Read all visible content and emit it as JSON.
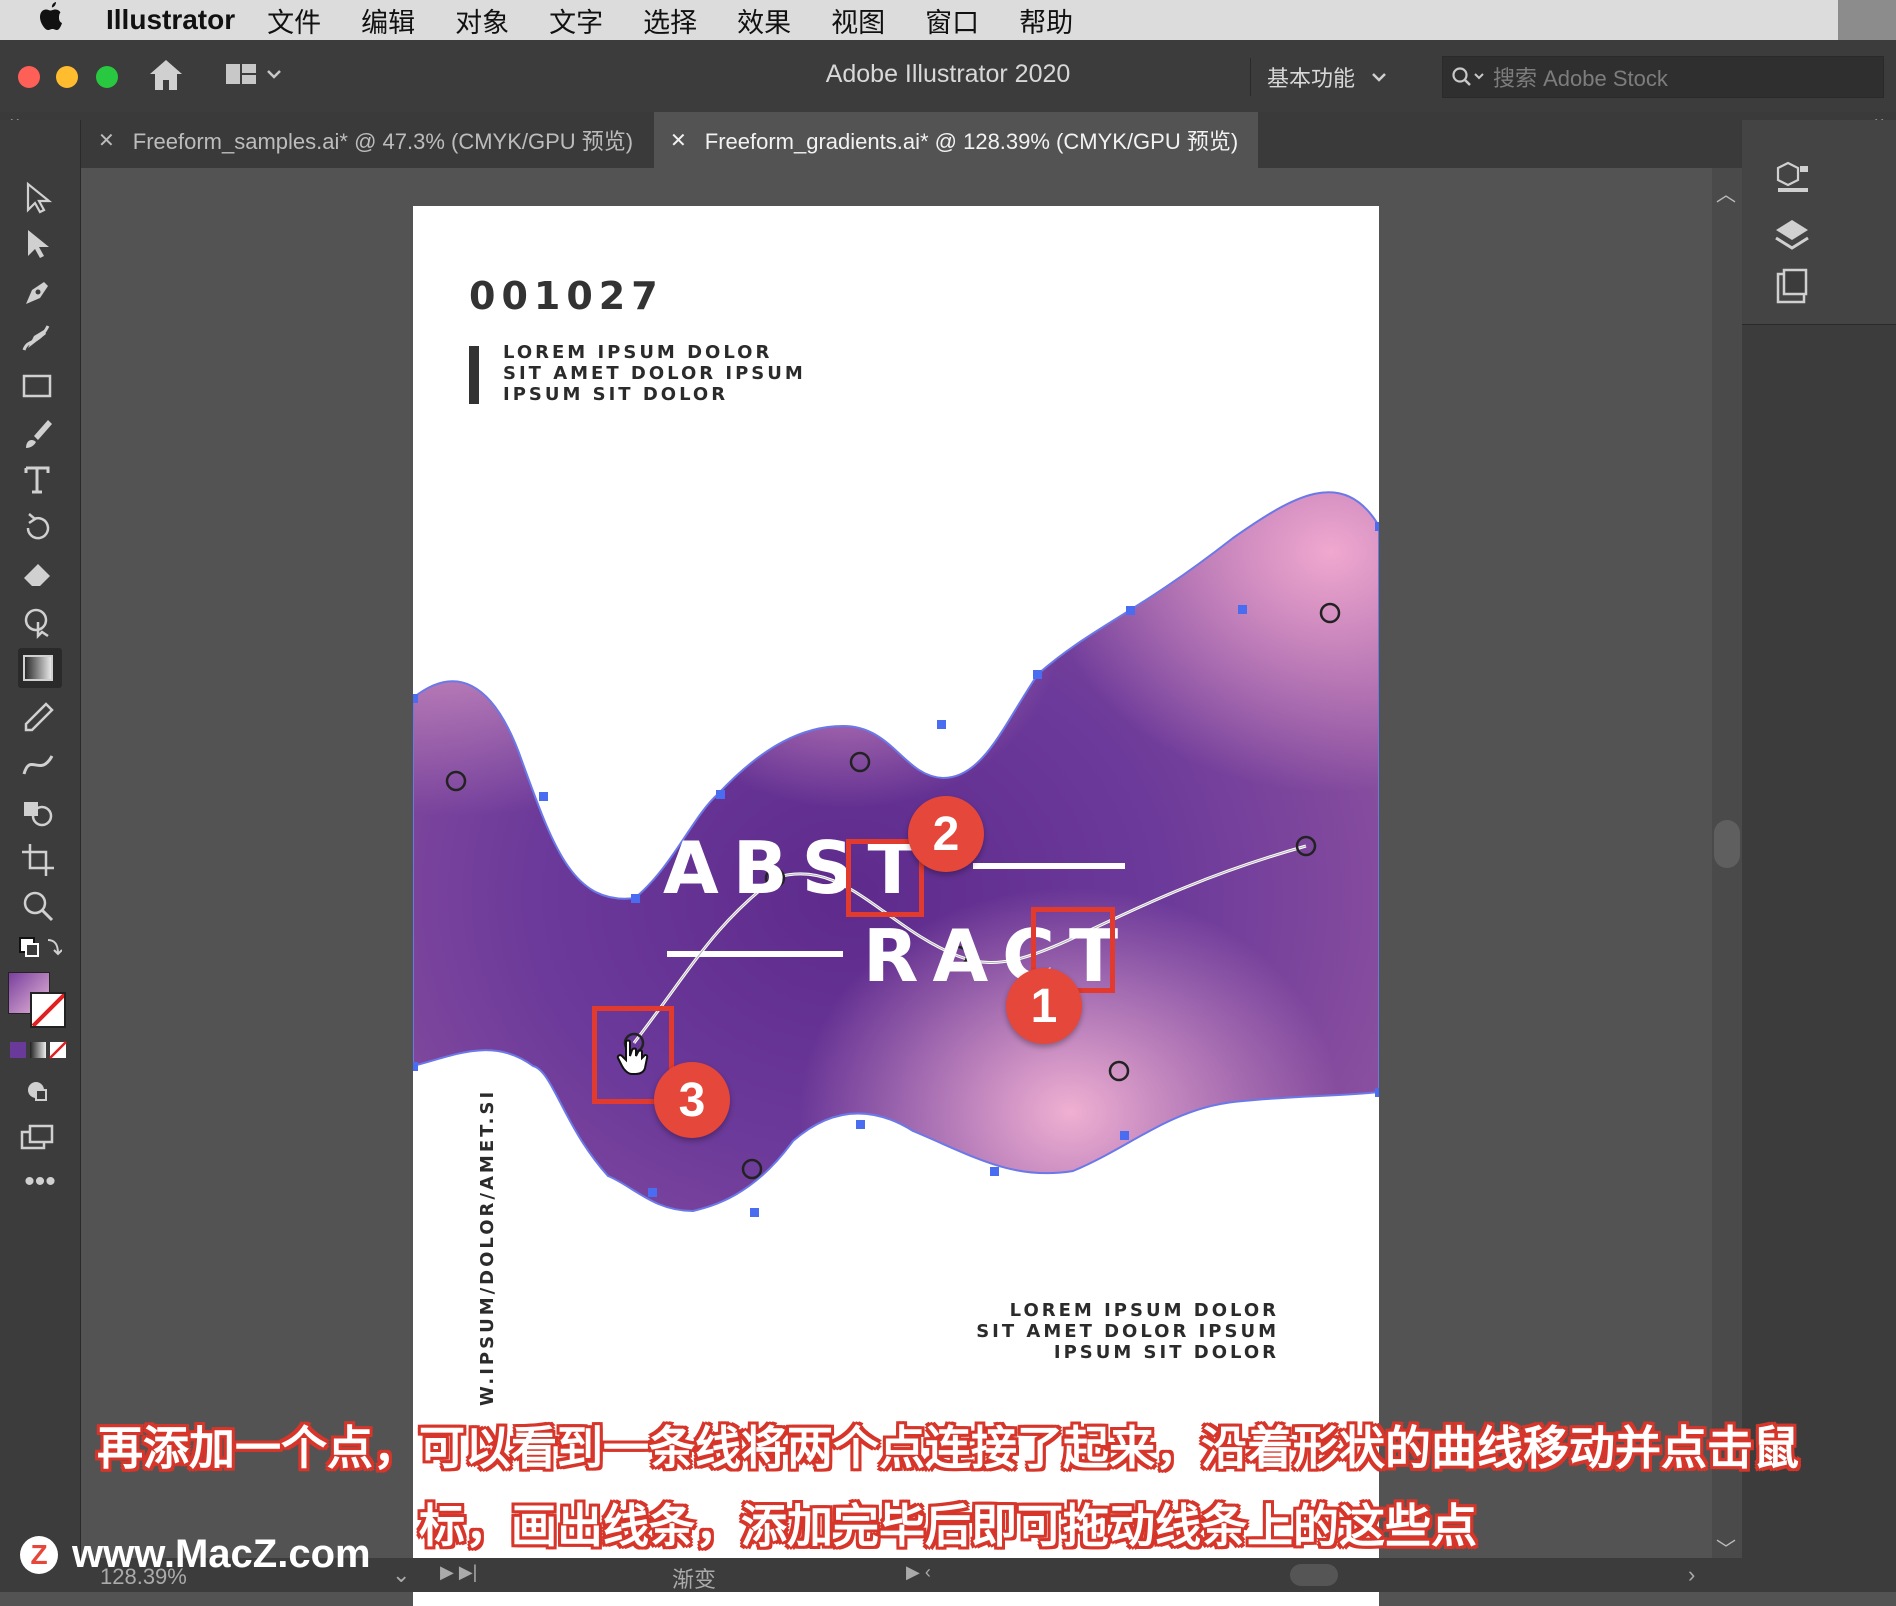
{
  "menubar": {
    "app_name": "Illustrator",
    "items": [
      "文件",
      "编辑",
      "对象",
      "文字",
      "选择",
      "效果",
      "视图",
      "窗口",
      "帮助"
    ]
  },
  "titlebar": {
    "title": "Adobe Illustrator 2020",
    "workspace": "基本功能",
    "search_placeholder": "搜索 Adobe Stock"
  },
  "tabs": [
    {
      "label": "Freeform_samples.ai* @ 47.3% (CMYK/GPU 预览)"
    },
    {
      "label": "Freeform_gradients.ai* @ 128.39% (CMYK/GPU 预览)"
    }
  ],
  "poster": {
    "number": "001027",
    "top_lines": [
      "LOREM IPSUM DOLOR",
      "SIT AMET DOLOR IPSUM",
      "IPSUM SIT DOLOR"
    ],
    "title_part1": "ABST",
    "title_part2": "RACT",
    "vertical_text": "W.IPSUM/DOLOR/AMET.SI",
    "bottom_lines": [
      "LOREM IPSUM DOLOR",
      "SIT AMET DOLOR IPSUM",
      "IPSUM SIT DOLOR"
    ]
  },
  "callouts": [
    "1",
    "2",
    "3"
  ],
  "caption": {
    "line1": "再添加一个点，可以看到一条线将两个点连接了起来，沿着形状的曲线移动并点击鼠",
    "line2": "标，画出线条，添加完毕后即可拖动线条上的这些点"
  },
  "statusbar": {
    "zoom": "128.39%",
    "label": "渐变"
  },
  "watermark": "www.MacZ.com",
  "colors": {
    "accent_red": "#e5473a",
    "gradient_purple": "#5a2a8a",
    "gradient_pink": "#e9a6c9"
  }
}
